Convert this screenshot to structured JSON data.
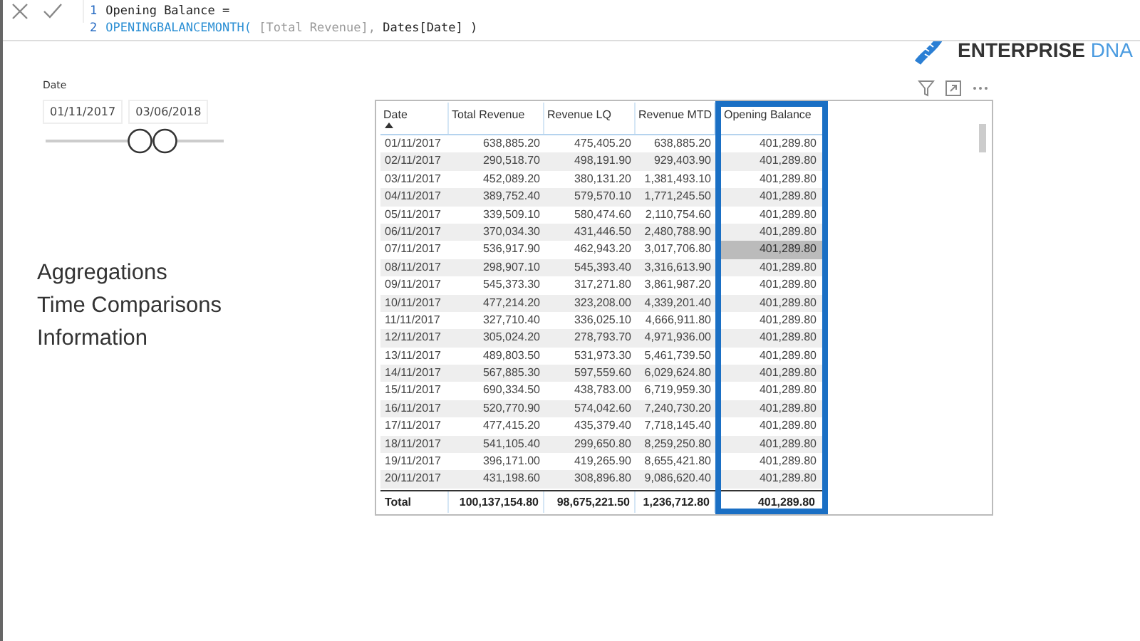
{
  "formula_bar": {
    "lines": [
      {
        "number": "1",
        "text": "Opening Balance ="
      },
      {
        "number": "2",
        "func": "OPENINGBALANCEMONTH(",
        "args": " [Total Revenue], ",
        "rest": "Dates[Date] )"
      }
    ]
  },
  "logo": {
    "word1": "ENTERPRISE",
    "word2": "DNA"
  },
  "slicer": {
    "label": "Date",
    "start": "01/11/2017",
    "end": "03/06/2018",
    "thumbs": [
      {
        "level": 0.53
      },
      {
        "level": 0.67
      }
    ]
  },
  "menu": [
    "Aggregations",
    "Time Comparisons",
    "Information"
  ],
  "table": {
    "columns": [
      {
        "label": "Date",
        "sorted": true
      },
      {
        "label": "Total Revenue",
        "sorted": false
      },
      {
        "label": "Revenue LQ",
        "sorted": false
      },
      {
        "label": "Revenue MTD",
        "sorted": false
      },
      {
        "label": "Opening Balance",
        "sorted": false
      }
    ],
    "rows": [
      {
        "cells": [
          "01/11/2017",
          "638,885.20",
          "475,405.20",
          "638,885.20",
          "401,289.80"
        ],
        "highlighted": false
      },
      {
        "cells": [
          "02/11/2017",
          "290,518.70",
          "498,191.90",
          "929,403.90",
          "401,289.80"
        ],
        "highlighted": false
      },
      {
        "cells": [
          "03/11/2017",
          "452,089.20",
          "380,131.20",
          "1,381,493.10",
          "401,289.80"
        ],
        "highlighted": false
      },
      {
        "cells": [
          "04/11/2017",
          "389,752.40",
          "579,570.10",
          "1,771,245.50",
          "401,289.80"
        ],
        "highlighted": false
      },
      {
        "cells": [
          "05/11/2017",
          "339,509.10",
          "580,474.60",
          "2,110,754.60",
          "401,289.80"
        ],
        "highlighted": false
      },
      {
        "cells": [
          "06/11/2017",
          "370,034.30",
          "431,446.50",
          "2,480,788.90",
          "401,289.80"
        ],
        "highlighted": false
      },
      {
        "cells": [
          "07/11/2017",
          "536,917.90",
          "462,943.20",
          "3,017,706.80",
          "401,289.80"
        ],
        "highlighted": true
      },
      {
        "cells": [
          "08/11/2017",
          "298,907.10",
          "545,393.40",
          "3,316,613.90",
          "401,289.80"
        ],
        "highlighted": false
      },
      {
        "cells": [
          "09/11/2017",
          "545,373.30",
          "317,271.80",
          "3,861,987.20",
          "401,289.80"
        ],
        "highlighted": false
      },
      {
        "cells": [
          "10/11/2017",
          "477,214.20",
          "323,208.00",
          "4,339,201.40",
          "401,289.80"
        ],
        "highlighted": false
      },
      {
        "cells": [
          "11/11/2017",
          "327,710.40",
          "336,025.10",
          "4,666,911.80",
          "401,289.80"
        ],
        "highlighted": false
      },
      {
        "cells": [
          "12/11/2017",
          "305,024.20",
          "278,793.70",
          "4,971,936.00",
          "401,289.80"
        ],
        "highlighted": false
      },
      {
        "cells": [
          "13/11/2017",
          "489,803.50",
          "531,973.30",
          "5,461,739.50",
          "401,289.80"
        ],
        "highlighted": false
      },
      {
        "cells": [
          "14/11/2017",
          "567,885.30",
          "597,559.60",
          "6,029,624.80",
          "401,289.80"
        ],
        "highlighted": false
      },
      {
        "cells": [
          "15/11/2017",
          "690,334.50",
          "438,783.00",
          "6,719,959.30",
          "401,289.80"
        ],
        "highlighted": false
      },
      {
        "cells": [
          "16/11/2017",
          "520,770.90",
          "574,042.60",
          "7,240,730.20",
          "401,289.80"
        ],
        "highlighted": false
      },
      {
        "cells": [
          "17/11/2017",
          "477,415.20",
          "435,379.40",
          "7,718,145.40",
          "401,289.80"
        ],
        "highlighted": false
      },
      {
        "cells": [
          "18/11/2017",
          "541,105.40",
          "299,650.80",
          "8,259,250.80",
          "401,289.80"
        ],
        "highlighted": false
      },
      {
        "cells": [
          "19/11/2017",
          "396,171.00",
          "419,265.90",
          "8,655,421.80",
          "401,289.80"
        ],
        "highlighted": false
      },
      {
        "cells": [
          "20/11/2017",
          "431,198.60",
          "308,896.80",
          "9,086,620.40",
          "401,289.80"
        ],
        "highlighted": false
      }
    ],
    "total": [
      "Total",
      "100,137,154.80",
      "98,675,221.50",
      "1,236,712.80",
      "401,289.80"
    ]
  }
}
